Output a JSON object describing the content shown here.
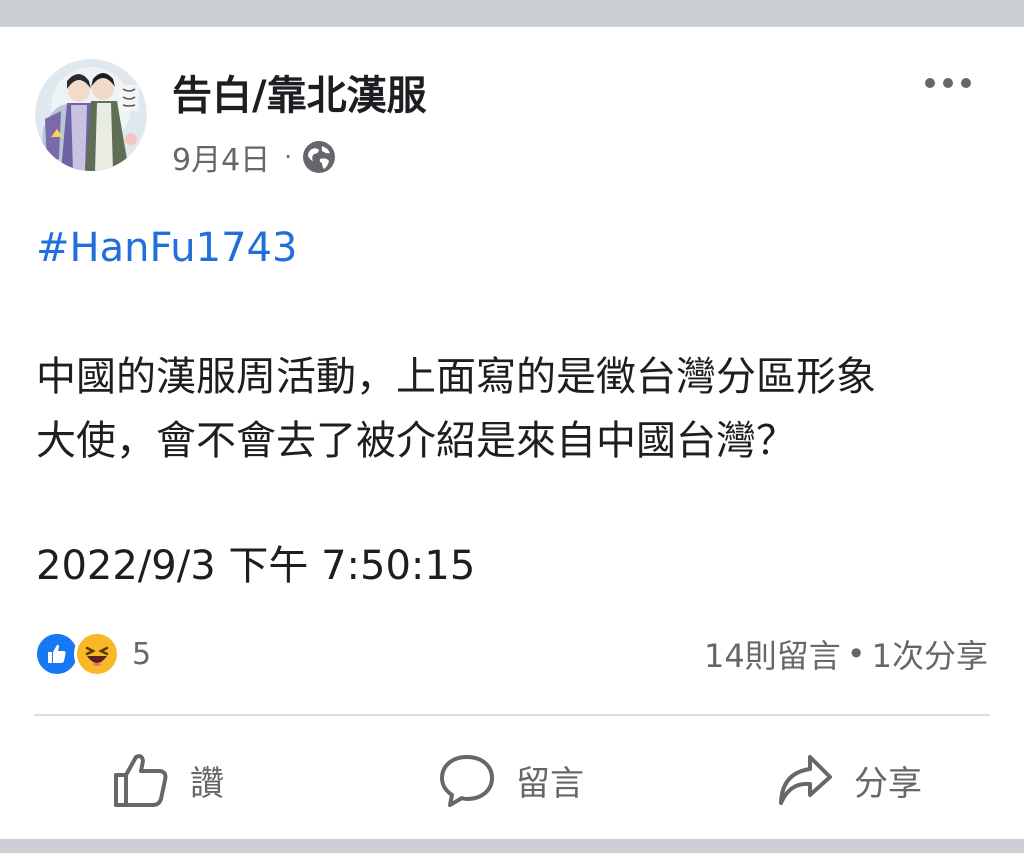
{
  "post": {
    "author": "告白/靠北漢服",
    "date": "9月4日",
    "meta_separator": "·",
    "visibility_icon": "globe-icon",
    "more_icon": "more-options-icon",
    "hashtag": "#HanFu1743",
    "body_lines": [
      "中國的漢服周活動，上面寫的是徵台灣分區形象",
      "大使，會不會去了被介紹是來自中國台灣？"
    ],
    "timestamp_text": "2022/9/3 下午 7:50:15"
  },
  "stats": {
    "reaction_icons": [
      "like-reaction-icon",
      "haha-reaction-icon"
    ],
    "reaction_count": "5",
    "comments": "14則留言",
    "separator": "•",
    "shares": "1次分享"
  },
  "actions": {
    "like_label": "讚",
    "comment_label": "留言",
    "share_label": "分享"
  },
  "colors": {
    "hashtag_link": "#216fdb",
    "like_blue": "#1877f2",
    "haha_yellow": "#f7b928",
    "secondary_text": "#65676b",
    "primary_text": "#1c1e21",
    "page_background": "#ccd0d5"
  }
}
